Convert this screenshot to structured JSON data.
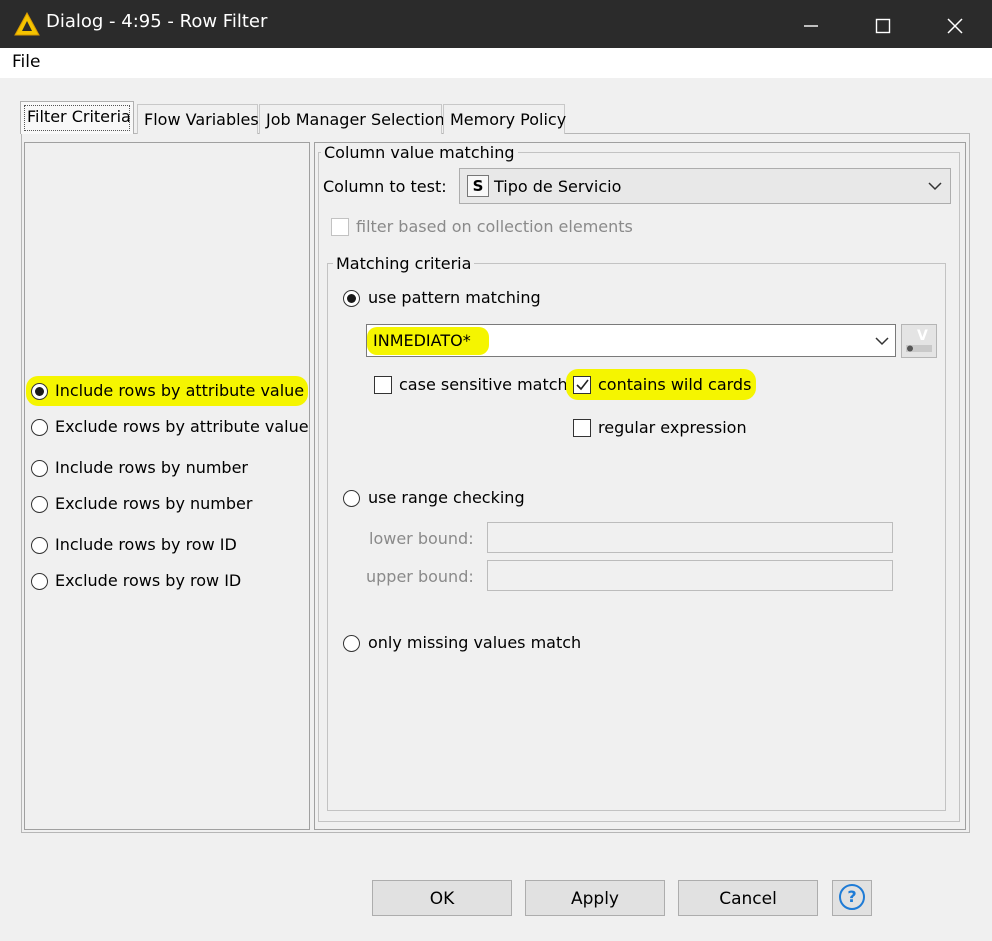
{
  "window": {
    "title": "Dialog - 4:95 - Row Filter",
    "icon": "warning-triangle-icon",
    "minimize": "—",
    "maximize": "☐",
    "close": "✕"
  },
  "menu": {
    "file": "File"
  },
  "tabs": [
    {
      "label": "Filter Criteria",
      "active": true
    },
    {
      "label": "Flow Variables"
    },
    {
      "label": "Job Manager Selection"
    },
    {
      "label": "Memory Policy"
    }
  ],
  "filter_modes": [
    {
      "label": "Include rows by attribute value",
      "selected": true,
      "highlighted": true
    },
    {
      "label": "Exclude rows by attribute value"
    },
    {
      "label": "Include rows by number"
    },
    {
      "label": "Exclude rows by number"
    },
    {
      "label": "Include rows by row ID"
    },
    {
      "label": "Exclude rows by row ID"
    }
  ],
  "column_matching": {
    "legend": "Column value matching",
    "column_label": "Column to test:",
    "column_type_badge": "S",
    "column_value": "Tipo de Servicio",
    "collection_label": "filter based on collection elements"
  },
  "matching_criteria": {
    "legend": "Matching criteria",
    "pattern_option": "use pattern matching",
    "pattern_value": "INMEDIATO*",
    "case_sensitive": "case sensitive match",
    "wild_cards": "contains wild cards",
    "wild_cards_checked": true,
    "regex": "regular expression",
    "range_option": "use range checking",
    "lower_bound": "lower bound:",
    "upper_bound": "upper bound:",
    "missing_option": "only missing values match"
  },
  "buttons": {
    "ok": "OK",
    "apply": "Apply",
    "cancel": "Cancel",
    "help": "?"
  },
  "colors": {
    "highlight": "#f5f500",
    "titlebar": "#2b2b2b",
    "help_blue": "#1e7bd6"
  }
}
